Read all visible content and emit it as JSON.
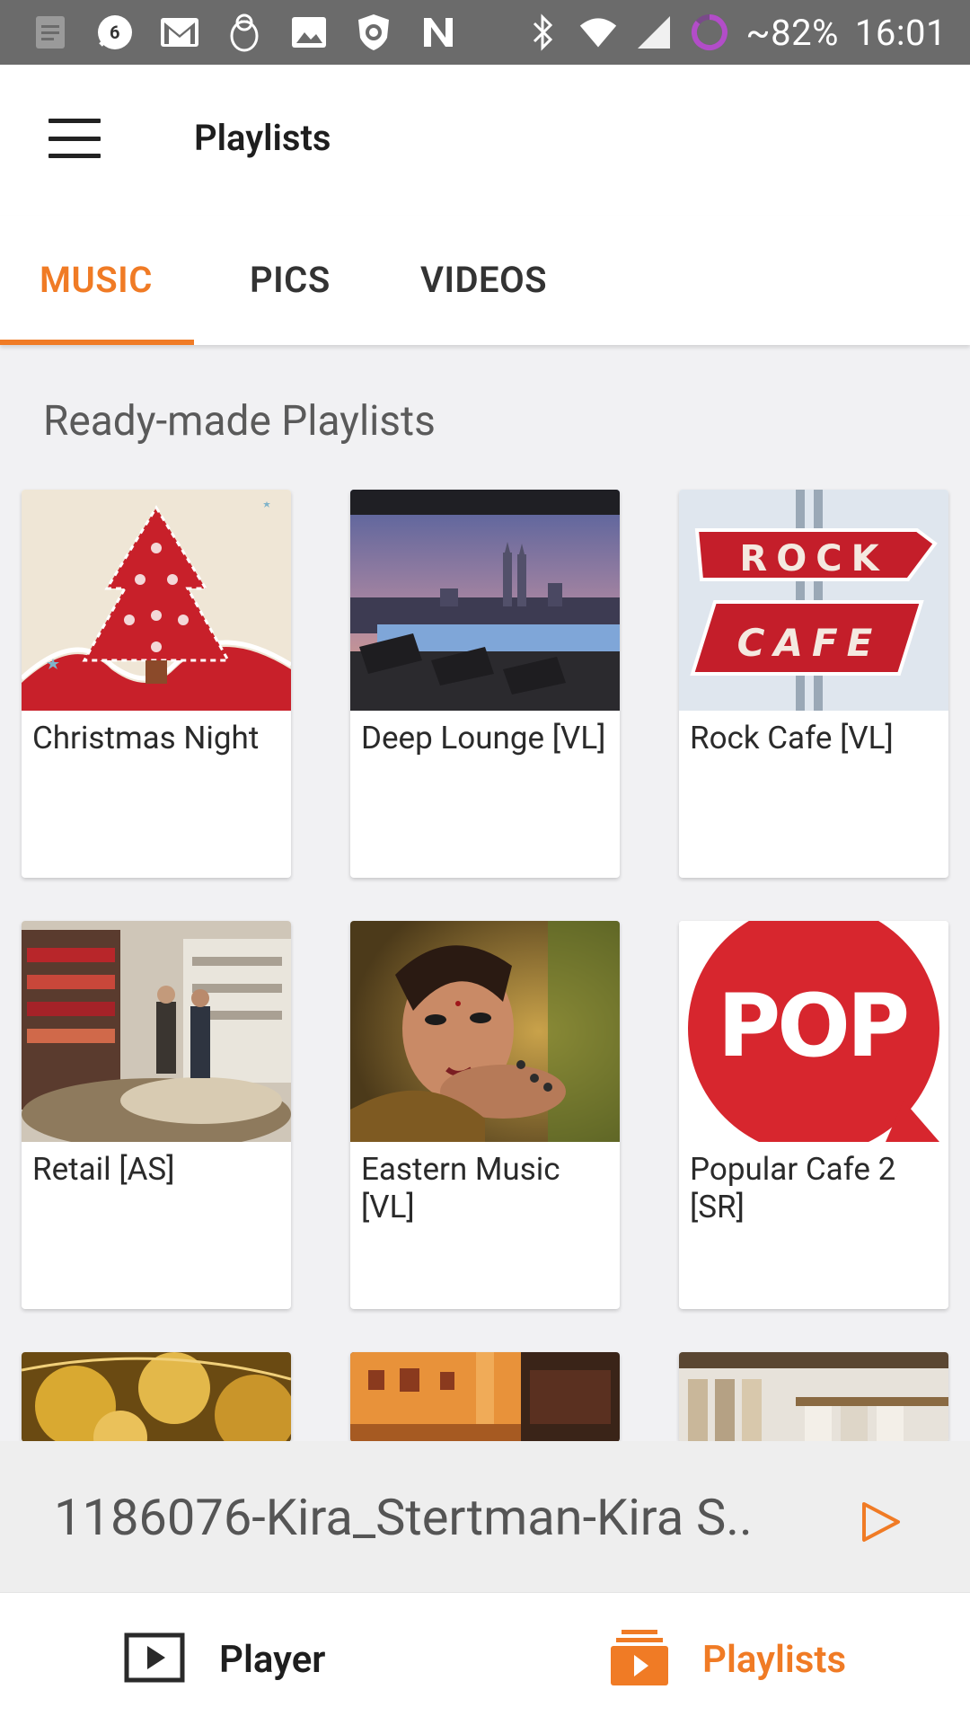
{
  "status_bar": {
    "notification_badge": "6",
    "battery": "~82%",
    "time": "16:01",
    "icons": [
      "doc-icon",
      "chat-badge-icon",
      "gmail-icon",
      "penguin-icon",
      "image-icon",
      "shield-icon",
      "n-icon",
      "bluetooth-icon",
      "wifi-icon",
      "signal-icon",
      "battery-ring-icon"
    ]
  },
  "app_bar": {
    "title": "Playlists",
    "menu_icon": "hamburger-menu-icon"
  },
  "tabs": [
    {
      "label": "MUSIC",
      "active": true
    },
    {
      "label": "PICS",
      "active": false
    },
    {
      "label": "VIDEOS",
      "active": false
    }
  ],
  "section": {
    "title": "Ready-made Playlists"
  },
  "playlists": [
    {
      "name": "Christmas Night"
    },
    {
      "name": "Deep Lounge [VL]"
    },
    {
      "name": "Rock Cafe [VL]",
      "sign_top": "ROCK",
      "sign_bottom": "CAFE"
    },
    {
      "name": "Retail [AS]"
    },
    {
      "name": "Eastern Music [VL]"
    },
    {
      "name": "Popular Cafe 2 [SR]",
      "logo_text": "POP"
    }
  ],
  "now_playing": {
    "title": "1186076-Kira_Stertman-Kira S..",
    "play_icon": "play-outline-icon"
  },
  "bottom_nav": {
    "player_label": "Player",
    "playlists_label": "Playlists",
    "active": "Playlists"
  },
  "colors": {
    "accent": "#f07b25",
    "status_bar": "#6b6b6b",
    "background": "#f1f1f3"
  }
}
